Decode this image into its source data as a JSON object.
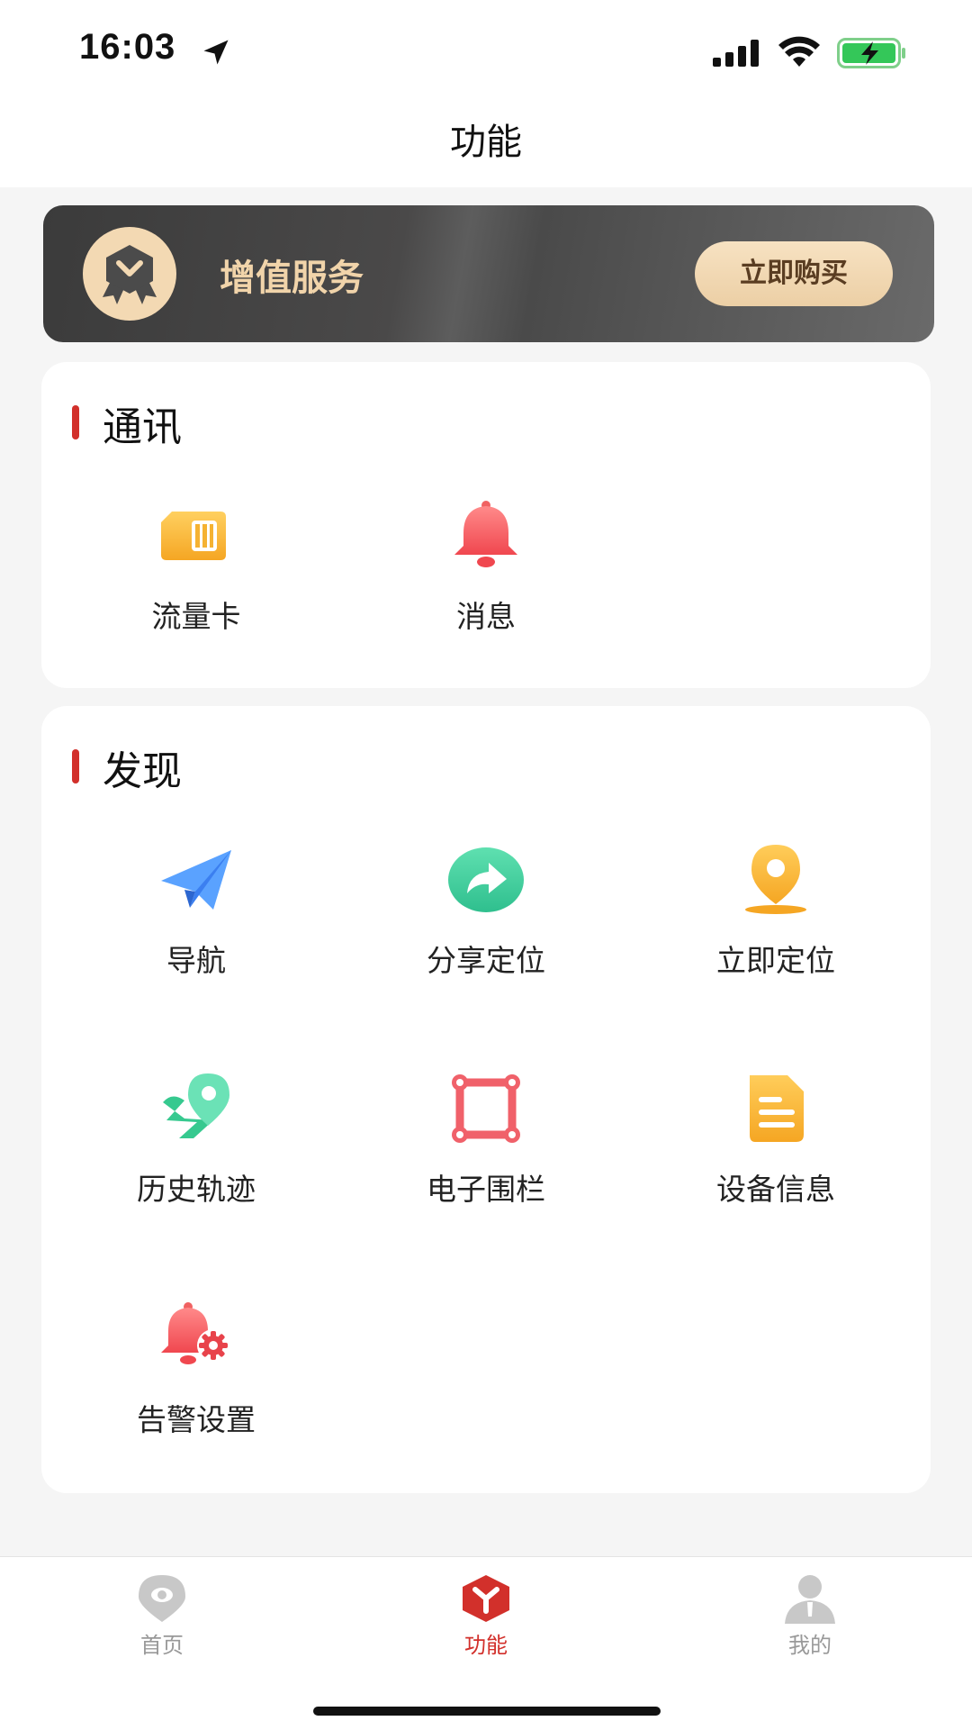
{
  "status_bar": {
    "time": "16:03",
    "battery_color": "#34c759"
  },
  "header": {
    "title": "功能"
  },
  "vip": {
    "title": "增值服务",
    "button": "立即购买"
  },
  "communication": {
    "title": "通讯",
    "items": [
      {
        "label": "流量卡",
        "icon": "sim-card-icon"
      },
      {
        "label": "消息",
        "icon": "bell-icon"
      }
    ]
  },
  "discover": {
    "title": "发现",
    "items": [
      {
        "label": "导航",
        "icon": "paper-plane-icon"
      },
      {
        "label": "分享定位",
        "icon": "share-arrow-icon"
      },
      {
        "label": "立即定位",
        "icon": "location-pin-icon"
      },
      {
        "label": "历史轨迹",
        "icon": "track-route-icon"
      },
      {
        "label": "电子围栏",
        "icon": "fence-icon"
      },
      {
        "label": "设备信息",
        "icon": "document-icon"
      },
      {
        "label": "告警设置",
        "icon": "alarm-settings-icon"
      }
    ]
  },
  "tabbar": {
    "items": [
      {
        "label": "首页",
        "icon": "home-pin-icon",
        "active": false
      },
      {
        "label": "功能",
        "icon": "function-icon",
        "active": true
      },
      {
        "label": "我的",
        "icon": "profile-icon",
        "active": false
      }
    ]
  },
  "colors": {
    "accent": "#d2302b",
    "gold": "#f1d4aa",
    "banner": "#4a4949"
  }
}
